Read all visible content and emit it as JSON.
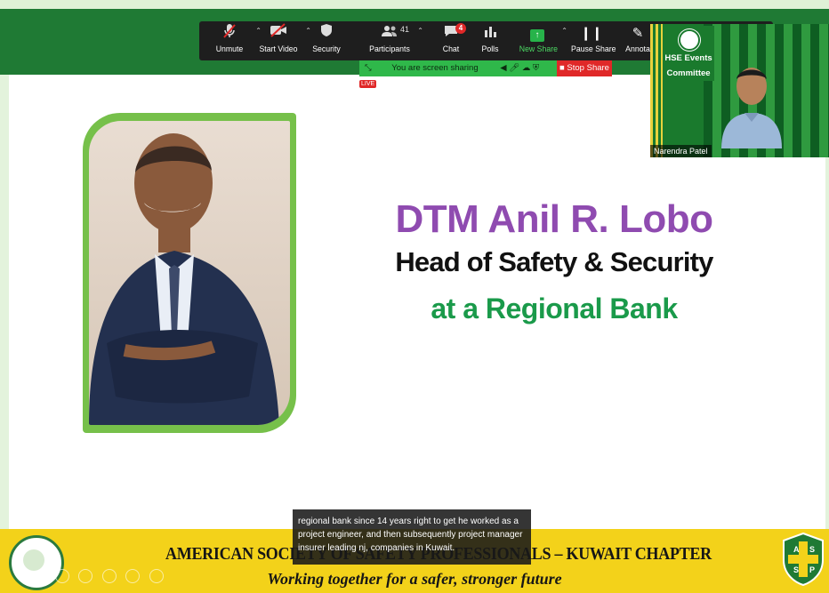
{
  "toolbar": {
    "unmute": "Unmute",
    "start_video": "Start Video",
    "security": "Security",
    "participants": "Participants",
    "participants_count": "41",
    "chat": "Chat",
    "chat_badge": "4",
    "polls": "Polls",
    "new_share": "New Share",
    "pause_share": "Pause Share",
    "annotate": "Annota"
  },
  "share_status": {
    "text": "You are screen sharing",
    "live": "LIVE",
    "stop": "Stop Share"
  },
  "video": {
    "logo_line1": "HSE Events",
    "logo_line2": "Committee",
    "participant_name": "Narendra Patel"
  },
  "slide": {
    "name": "DTM Anil R. Lobo",
    "role": "Head of Safety & Security",
    "org": "at a Regional Bank",
    "footer_title": "AMERICAN SOCIETY OF SAFETY PROFESSIONALS – KUWAIT CHAPTER",
    "footer_tagline": "Working together for a safer, stronger future",
    "assp_letters": [
      "A",
      "S",
      "S",
      "P"
    ]
  },
  "caption": {
    "text": "regional bank since 14 years right to get he worked as a project engineer, and then subsequently project manager insurer leading nj, companies in Kuwait."
  },
  "colors": {
    "name": "#8f4bb0",
    "org": "#1a9a4a",
    "footer": "#f3d21a",
    "frame": "#76c04a",
    "toolbar": "#1e1e1e",
    "share_green": "#2fb84a",
    "stop_red": "#e02828"
  }
}
